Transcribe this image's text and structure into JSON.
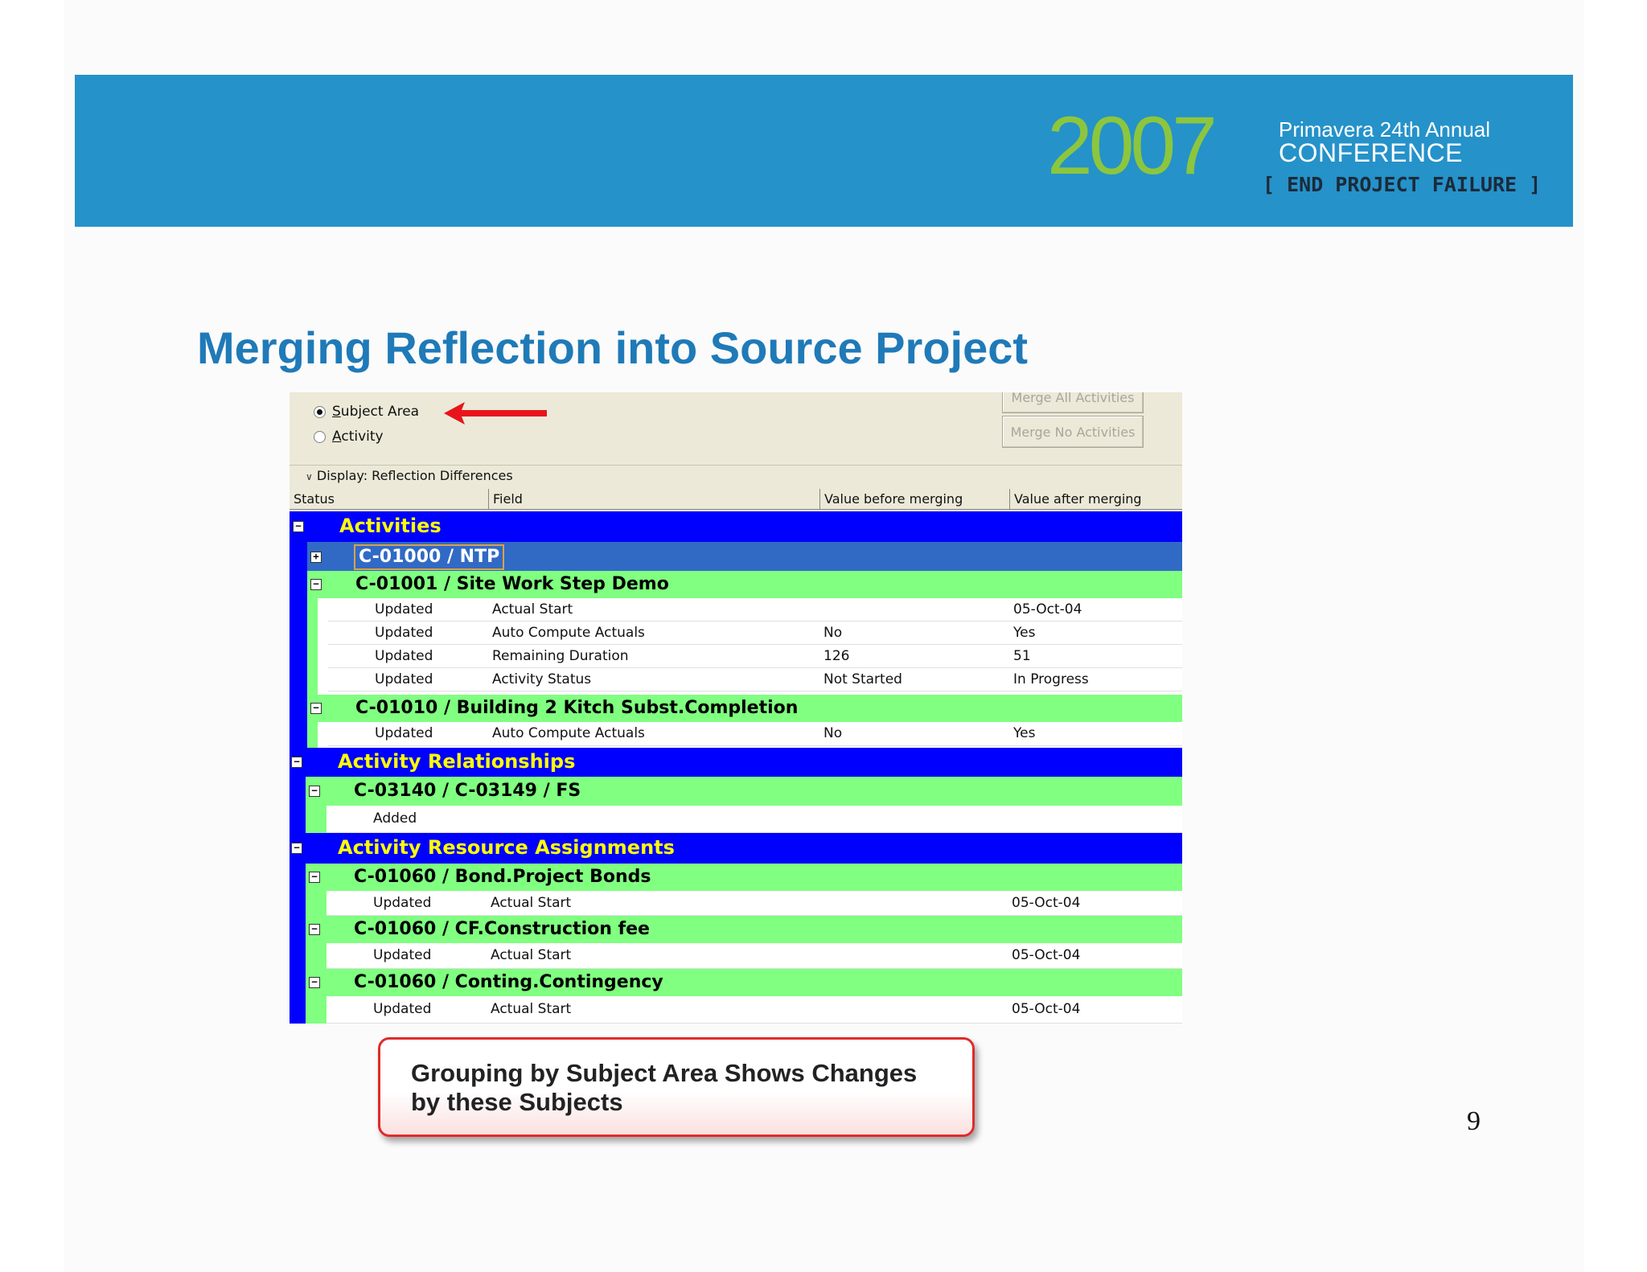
{
  "banner": {
    "year": "2007",
    "conference_line1": "Primavera 24th Annual",
    "conference_line2": "CONFERENCE",
    "tagline": "[ END PROJECT FAILURE ]"
  },
  "slide": {
    "title": "Merging Reflection into Source Project",
    "page_number": "9",
    "callout_line1": "Grouping by Subject Area Shows Changes",
    "callout_line2": "by these Subjects"
  },
  "options": {
    "subject_area_prefix": "",
    "subject_area_underline": "S",
    "subject_area_rest": "ubject Area",
    "activity_underline": "A",
    "activity_rest": "ctivity",
    "selected": "Subject Area"
  },
  "buttons": {
    "merge_all": "Merge All Activities",
    "merge_no": "Merge No Activities"
  },
  "display": {
    "label": "Display: Reflection Differences"
  },
  "columns": {
    "status": "Status",
    "field": "Field",
    "before": "Value before merging",
    "after": "Value after merging"
  },
  "groups": {
    "activities": "Activities",
    "relationships": "Activity Relationships",
    "resources": "Activity Resource Assignments"
  },
  "rows": {
    "ntp": "C-01000 / NTP",
    "site_work": "C-01001 / Site Work Step Demo",
    "sw1": {
      "status": "Updated",
      "field": "Actual Start",
      "before": "",
      "after": "05-Oct-04"
    },
    "sw2": {
      "status": "Updated",
      "field": "Auto Compute Actuals",
      "before": "No",
      "after": "Yes"
    },
    "sw3": {
      "status": "Updated",
      "field": "Remaining Duration",
      "before": "126",
      "after": "51"
    },
    "sw4": {
      "status": "Updated",
      "field": "Activity Status",
      "before": "Not Started",
      "after": "In Progress"
    },
    "kitch": "C-01010 / Building 2 Kitch Subst.Completion",
    "k1": {
      "status": "Updated",
      "field": "Auto Compute Actuals",
      "before": "No",
      "after": "Yes"
    },
    "rel": "C-03140 / C-03149 / FS",
    "rel1": {
      "status": "Added"
    },
    "bond": "C-01060 / Bond.Project Bonds",
    "b1": {
      "status": "Updated",
      "field": "Actual Start",
      "after": "05-Oct-04"
    },
    "cf": "C-01060 / CF.Construction fee",
    "c1": {
      "status": "Updated",
      "field": "Actual Start",
      "after": "05-Oct-04"
    },
    "conting": "C-01060 / Conting.Contingency",
    "ct1": {
      "status": "Updated",
      "field": "Actual Start",
      "after": "05-Oct-04"
    }
  },
  "colors": {
    "banner": "#2592c9",
    "year": "#8cc63e",
    "title": "#1f7ab8",
    "group_bg": "#0000ff",
    "group_text": "#ffff00",
    "subgroup_bg": "#80ff80",
    "selected_bg": "#316ac5",
    "arrow": "#e8141c",
    "callout_border": "#e02b2b"
  }
}
